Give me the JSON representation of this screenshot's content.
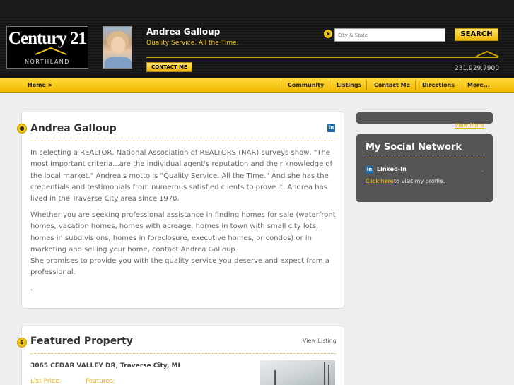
{
  "header": {
    "logo_main": "Century 21",
    "logo_sub": "NORTHLAND",
    "agent_name": "Andrea Galloup",
    "tagline": "Quality Service. All the Time.",
    "contact_label": "CONTACT ME",
    "search_placeholder": "City & State",
    "search_label": "SEARCH",
    "phone": "231.929.7900"
  },
  "nav": {
    "home": "Home >",
    "items": [
      "Community",
      "Listings",
      "Contact Me",
      "Directions",
      "More..."
    ]
  },
  "about": {
    "title": "Andrea Galloup",
    "paragraph1": "In selecting a REALTOR, National Association of REALTORS (NAR) surveys show, \"The most important criteria...are the individual agent's reputation and their knowledge of the local market.\"  Andrea's motto is \"Quality Service.  All the Time.\"  And she has the credentials and testimonials from numerous satisfied clients to prove it.  Andrea has lived in the Traverse City area since 1970.",
    "paragraph2": "Whether you are seeking professional assistance in finding homes for sale (waterfront homes, vacation homes, homes with acreage, homes in town with small city lots, homes in subdivisions, homes in foreclosure, executive homes, or condos) or in marketing and selling your home, contact Andrea Galloup.",
    "paragraph3": "She promises to provide you with the quality service you deserve and expect from a professional.",
    "trailing": "."
  },
  "featured": {
    "title": "Featured Property",
    "view_listing": "View Listing",
    "address": "3065 CEDAR VALLEY DR, Traverse City, MI",
    "list_price_label": "List Price:",
    "features_label": "Features:"
  },
  "sidebar": {
    "view_more": "View More",
    "social_title": "My Social Network",
    "linkedin_label": "Linked-In",
    "click_here": "Click here",
    "visit_text": "to visit my profile.",
    "dot": "."
  },
  "colors": {
    "accent": "#f2c414",
    "header_bg": "#1a1a1a",
    "sidebar_bg": "#555555"
  }
}
